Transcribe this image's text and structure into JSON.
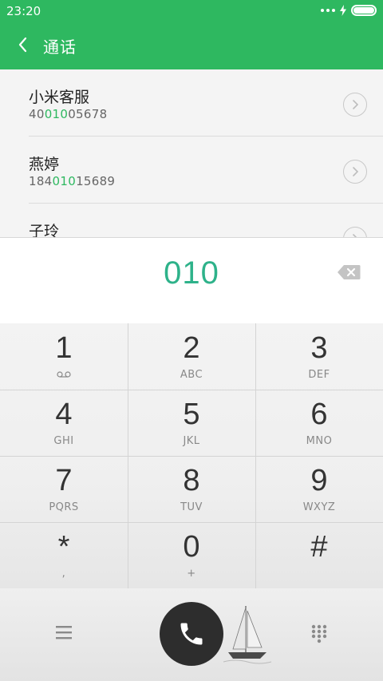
{
  "status_bar": {
    "time": "23:20"
  },
  "header": {
    "title": "通话"
  },
  "results": [
    {
      "name": "小米客服",
      "number_pre": "40",
      "number_match": "010",
      "number_post": "05678"
    },
    {
      "name": "燕婷",
      "number_pre": "184",
      "number_match": "010",
      "number_post": "15689"
    },
    {
      "name": "子玲",
      "number_pre": "",
      "number_match": "",
      "number_post": ""
    }
  ],
  "dialed_number": "010",
  "keypad": [
    {
      "digit": "1",
      "letters": ""
    },
    {
      "digit": "2",
      "letters": "ABC"
    },
    {
      "digit": "3",
      "letters": "DEF"
    },
    {
      "digit": "4",
      "letters": "GHI"
    },
    {
      "digit": "5",
      "letters": "JKL"
    },
    {
      "digit": "6",
      "letters": "MNO"
    },
    {
      "digit": "7",
      "letters": "PQRS"
    },
    {
      "digit": "8",
      "letters": "TUV"
    },
    {
      "digit": "9",
      "letters": "WXYZ"
    },
    {
      "digit": "*",
      "letters": ","
    },
    {
      "digit": "0",
      "letters": "+"
    },
    {
      "digit": "#",
      "letters": ""
    }
  ],
  "icons": {
    "back": "chevron-left-icon",
    "detail": "chevron-right-circle-icon",
    "backspace": "backspace-icon",
    "voicemail": "voicemail-icon",
    "menu": "menu-icon",
    "call": "phone-icon",
    "dialpad": "dialpad-icon"
  },
  "colors": {
    "accent": "#2eb860",
    "dialed_text": "#2eb28a",
    "call_button": "#2d2d2d"
  }
}
